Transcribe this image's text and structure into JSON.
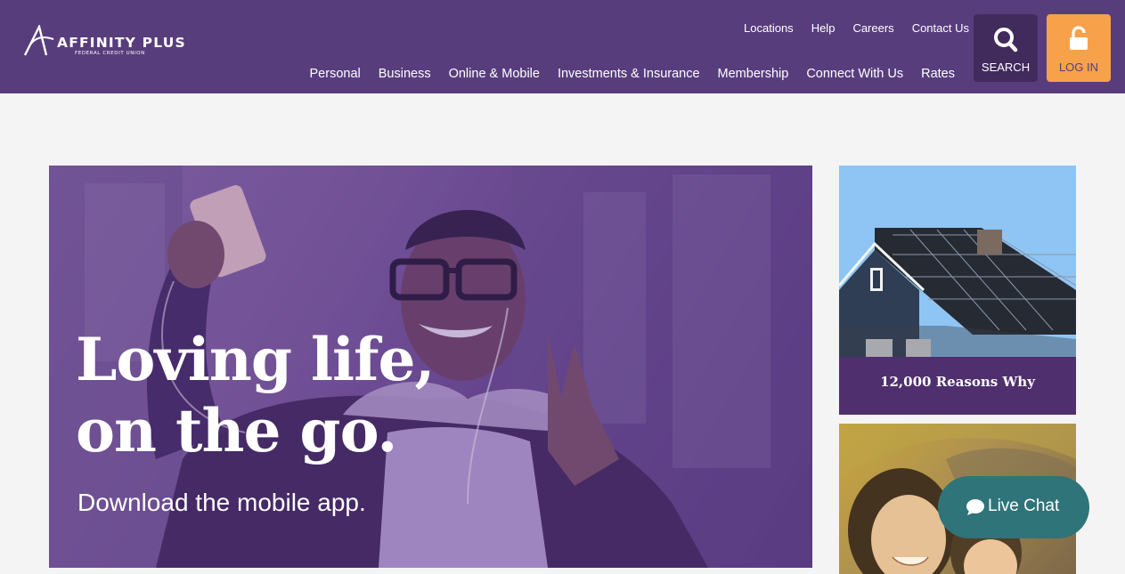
{
  "brand": {
    "name": "AFFINITY PLUS",
    "tagline": "FEDERAL CREDIT UNION"
  },
  "utility_nav": [
    "Locations",
    "Help",
    "Careers",
    "Contact Us"
  ],
  "main_nav": [
    "Personal",
    "Business",
    "Online & Mobile",
    "Investments & Insurance",
    "Membership",
    "Connect With Us",
    "Rates"
  ],
  "search": {
    "label": "SEARCH",
    "icon": "search-icon"
  },
  "login": {
    "label": "LOG IN",
    "icon": "unlock-icon"
  },
  "hero": {
    "headline_line1": "Loving life,",
    "headline_line2": "on the go.",
    "subline": "Download the mobile app."
  },
  "cards": [
    {
      "caption": "12,000 Reasons Why"
    }
  ],
  "live_chat": {
    "label": "Live Chat",
    "icon": "chat-bubble-icon"
  },
  "colors": {
    "header": "#583d7d",
    "search_bg": "#412b5d",
    "login_bg": "#f8a14b",
    "card_caption": "#4f2f6e",
    "live_chat": "#2f7479",
    "page_bg": "#f4f4f4"
  }
}
